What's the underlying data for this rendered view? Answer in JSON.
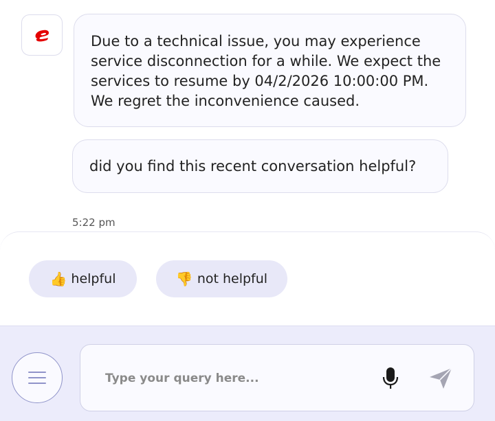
{
  "messages": [
    {
      "sender": "bot",
      "text": "Due to a technical issue, you may experience service disconnection for a while. We expect the services to resume by 04/2/2026 10:00:00 PM. We regret the inconvenience caused."
    },
    {
      "sender": "bot",
      "text": "did you find this recent conversation helpful?"
    }
  ],
  "timestamp": "5:22 pm",
  "quick_replies": [
    {
      "emoji": "👍",
      "label": "helpful",
      "icon": "thumbs-up-icon"
    },
    {
      "emoji": "👎",
      "label": "not helpful",
      "icon": "thumbs-down-icon"
    }
  ],
  "input": {
    "placeholder": "Type your query here...",
    "value": ""
  },
  "icons": {
    "avatar": "airtel-logo-icon",
    "menu": "hamburger-menu-icon",
    "mic": "microphone-icon",
    "send": "send-icon"
  },
  "colors": {
    "brand": "#e40000",
    "accent": "#8f93c9",
    "chip_bg": "#e8e8f8",
    "input_bar_bg": "#ececfb"
  }
}
